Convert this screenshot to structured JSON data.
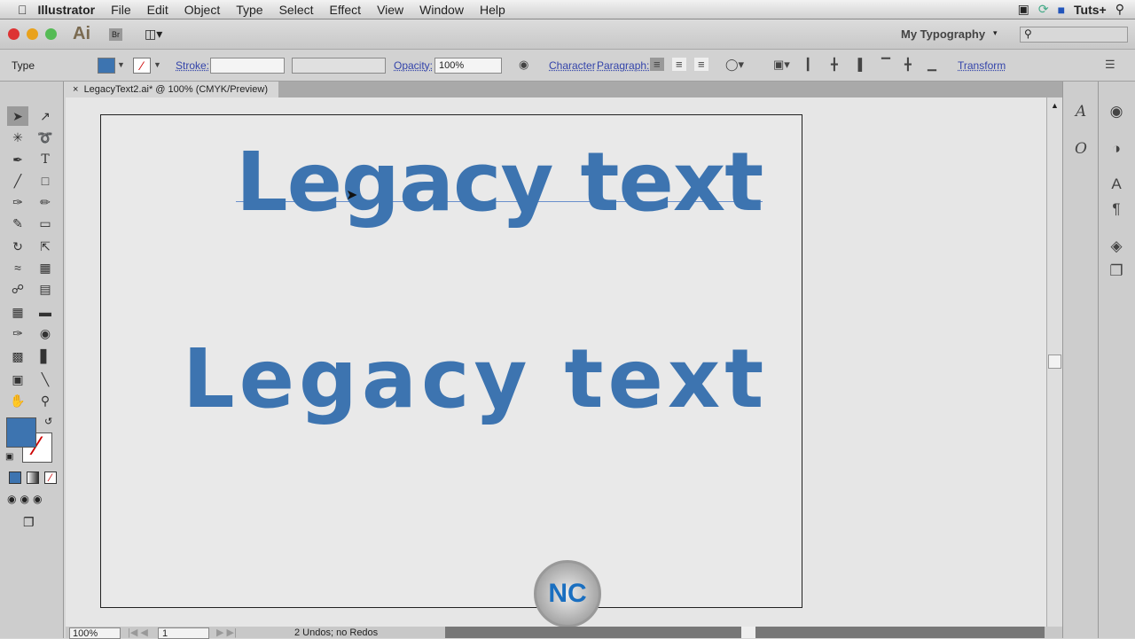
{
  "menubar": {
    "app": "Illustrator",
    "items": [
      "File",
      "Edit",
      "Object",
      "Type",
      "Select",
      "Effect",
      "View",
      "Window",
      "Help"
    ],
    "right_label": "Tuts+"
  },
  "appbar": {
    "logo": "Ai",
    "bridge": "Br",
    "workspace": "My Typography",
    "search_placeholder": ""
  },
  "control": {
    "tool_label": "Type",
    "stroke_label": "Stroke:",
    "opacity_label": "Opacity:",
    "opacity_value": "100%",
    "character_label": "Character",
    "paragraph_label": "Paragraph:",
    "transform_label": "Transform",
    "fill_color": "#3d74b0"
  },
  "document": {
    "tab_title": "LegacyText2.ai* @ 100% (CMYK/Preview)",
    "text1": "Legacy text",
    "text2": "Legacy text",
    "text_color": "#3d74b0"
  },
  "status": {
    "zoom": "100%",
    "page": "1",
    "undo_text": "2 Undos; no Redos"
  }
}
